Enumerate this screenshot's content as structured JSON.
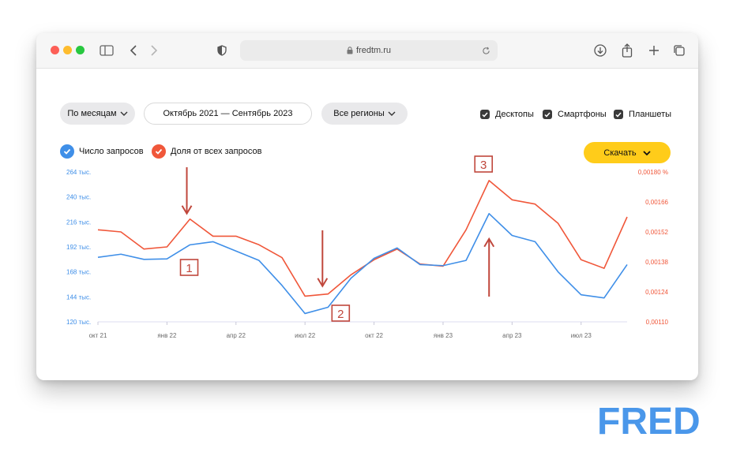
{
  "browser": {
    "url": "fredtm.ru",
    "traffic_lights": [
      "#fd5f57",
      "#febc2e",
      "#28c840"
    ]
  },
  "toolbar": {
    "period_label": "По месяцам",
    "date_range_label": "Октябрь 2021 — Сентябрь 2023",
    "region_label": "Все регионы",
    "devices": [
      {
        "label": "Десктопы",
        "checked": true
      },
      {
        "label": "Смартфоны",
        "checked": true
      },
      {
        "label": "Планшеты",
        "checked": true
      }
    ],
    "download_label": "Скачать"
  },
  "legend": {
    "queries_label": "Число запросов",
    "share_label": "Доля от всех запросов"
  },
  "colors": {
    "queries": "#3f8fe8",
    "share": "#f0573a",
    "annotation": "#c0473c",
    "download": "#ffcc1a"
  },
  "chart_data": {
    "type": "line",
    "x": [
      "окт 21",
      "ноя 21",
      "дек 21",
      "янв 22",
      "фев 22",
      "мар 22",
      "апр 22",
      "май 22",
      "июн 22",
      "июл 22",
      "авг 22",
      "сен 22",
      "окт 22",
      "ноя 22",
      "дек 22",
      "янв 23",
      "фев 23",
      "мар 23",
      "апр 23",
      "май 23",
      "июн 23",
      "июл 23",
      "авг 23",
      "сен 23"
    ],
    "x_tick_labels": [
      "окт 21",
      "янв 22",
      "апр 22",
      "июл 22",
      "окт 22",
      "янв 23",
      "апр 23",
      "июл 23"
    ],
    "x_tick_index": [
      0,
      3,
      6,
      9,
      12,
      15,
      18,
      21
    ],
    "series": [
      {
        "name": "Число запросов",
        "axis": "left",
        "values": [
          182000,
          185000,
          180000,
          180500,
          194000,
          197000,
          188000,
          179000,
          155000,
          128000,
          134000,
          162000,
          181000,
          191000,
          175000,
          174000,
          179000,
          224000,
          203000,
          197000,
          168000,
          146000,
          143000,
          175000
        ]
      },
      {
        "name": "Доля от всех запросов",
        "axis": "right",
        "values": [
          0.00153,
          0.00152,
          0.00144,
          0.00145,
          0.00158,
          0.0015,
          0.0015,
          0.00146,
          0.0014,
          0.00122,
          0.00123,
          0.00132,
          0.00139,
          0.00144,
          0.00137,
          0.00136,
          0.00153,
          0.00176,
          0.00167,
          0.00165,
          0.00156,
          0.00139,
          0.00135,
          0.00159
        ]
      }
    ],
    "y_left_ticks": [
      "264 тыс.",
      "240 тыс.",
      "216 тыс.",
      "192 тыс.",
      "168 тыс.",
      "144 тыс.",
      "120 тыс."
    ],
    "y_left_range": [
      120000,
      264000
    ],
    "y_right_ticks": [
      "0,00180 %",
      "0,00166",
      "0,00152",
      "0,00138",
      "0,00124",
      "0,00110"
    ],
    "y_right_range": [
      0.0011,
      0.0018
    ],
    "annotations": [
      {
        "label": "1",
        "x": "фев 22"
      },
      {
        "label": "2",
        "x": "авг 22"
      },
      {
        "label": "3",
        "x": "мар 23"
      }
    ]
  },
  "watermark": "FRED"
}
